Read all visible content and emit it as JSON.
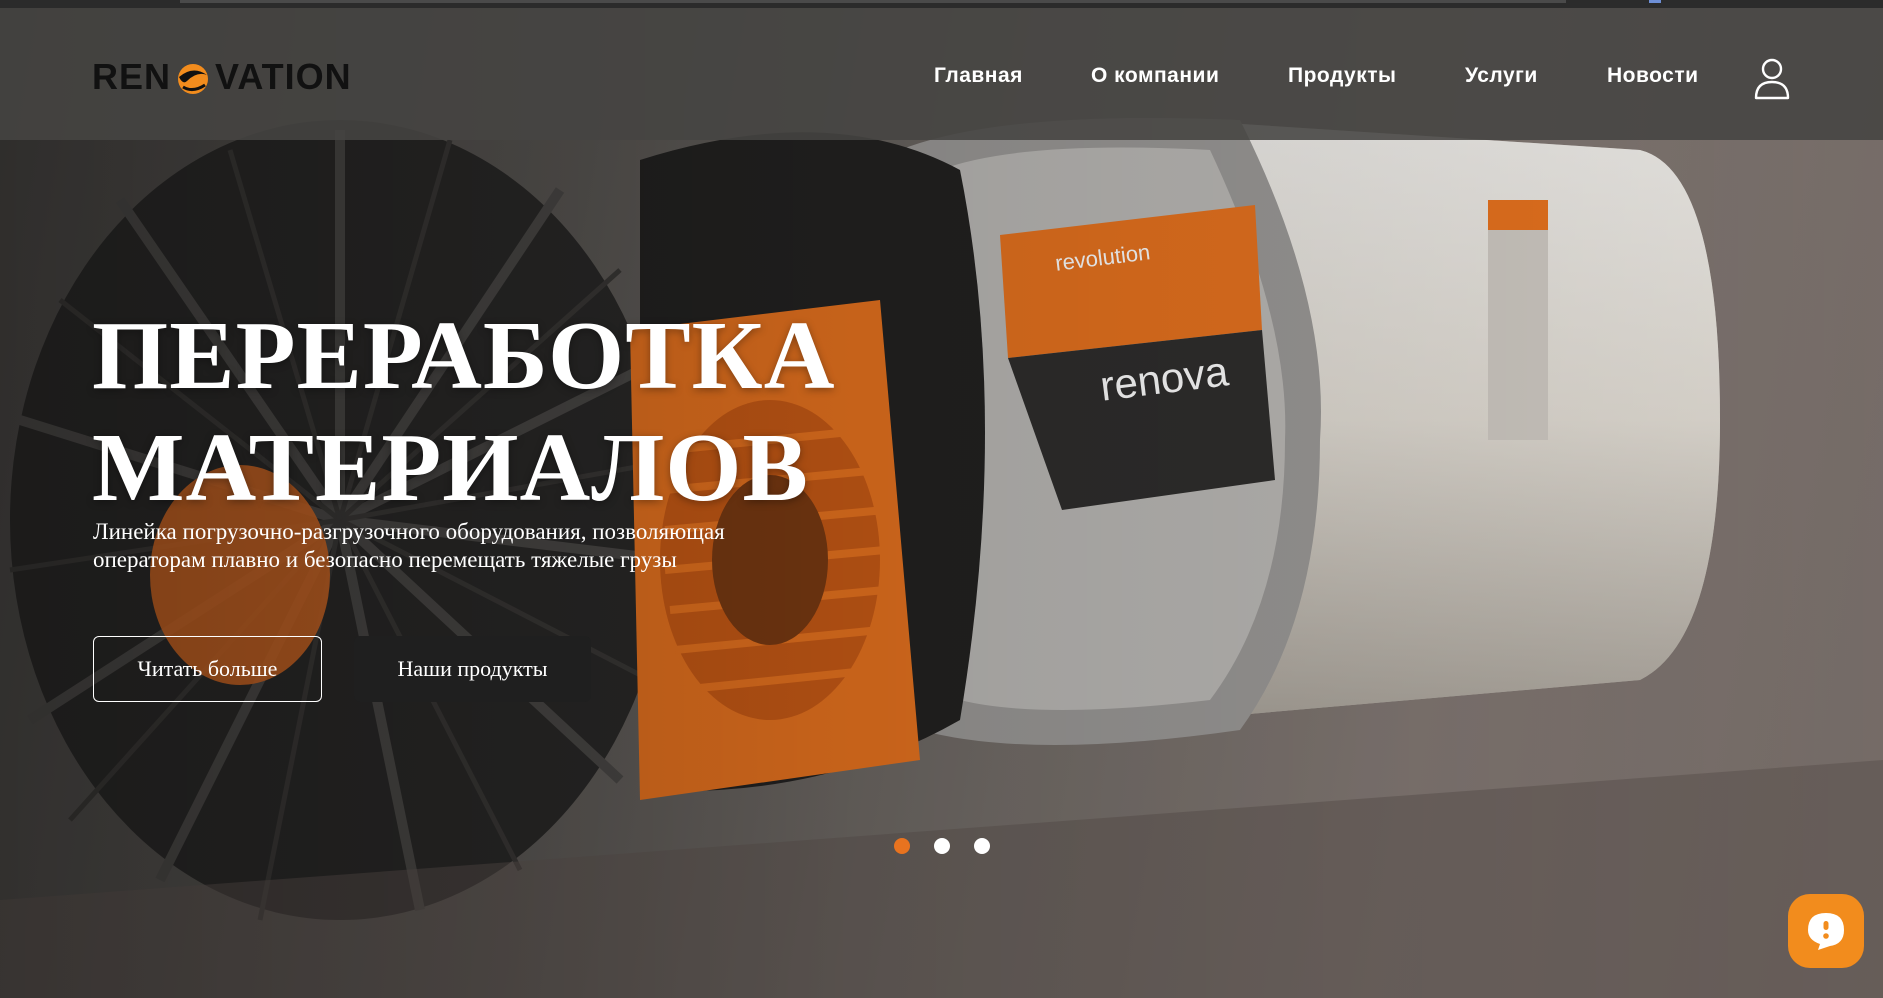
{
  "brand": {
    "logo_left": "REN",
    "logo_right": "VATION",
    "accent_color": "#f28c1d"
  },
  "nav": {
    "items": [
      "Главная",
      "О компании",
      "Продукты",
      "Услуги",
      "Новости"
    ],
    "user_icon": "user-icon"
  },
  "hero": {
    "title_line1": "ПЕРЕРАБОТКА",
    "title_line2": "МАТЕРИАЛОВ",
    "subtitle_line1": "Линейка погрузочно-разгрузочного оборудования, позволяющая",
    "subtitle_line2": "операторам плавно и безопасно перемещать тяжелые грузы",
    "button_read_more": "Читать больше",
    "button_products": "Наши продукты",
    "label_brand_1": "revolution",
    "label_brand_2": "renova"
  },
  "slider": {
    "count": 3,
    "active_index": 0,
    "active_color": "#e8731f",
    "inactive_color": "#ffffff"
  },
  "chat_widget": {
    "icon": "chat-bubble-icon",
    "color": "#f28c1d"
  }
}
